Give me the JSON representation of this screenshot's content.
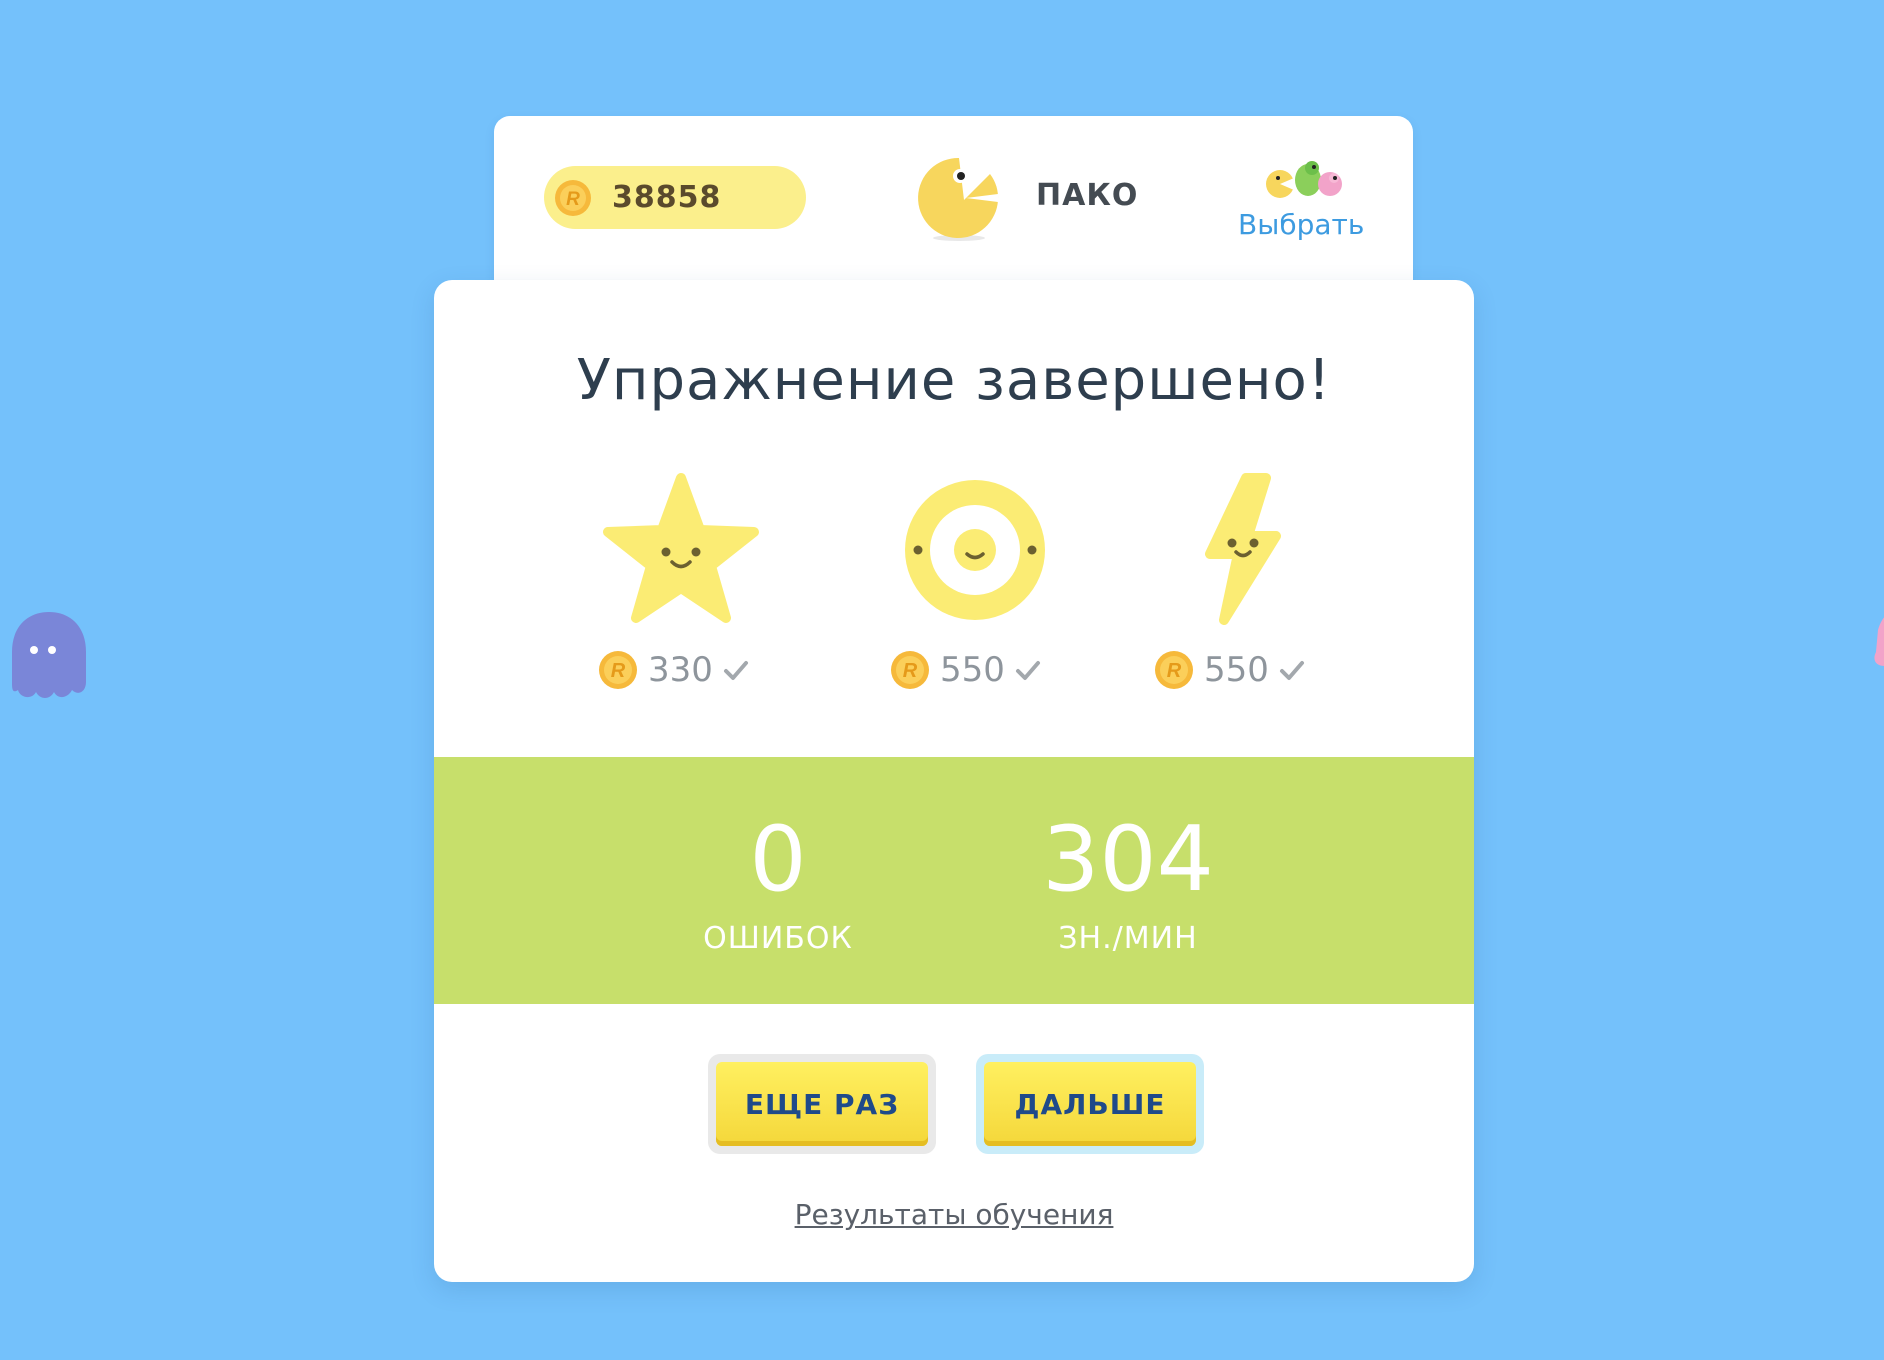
{
  "header": {
    "coins": "38858",
    "character_name": "ПАКО",
    "choose_link": "Выбрать"
  },
  "result": {
    "title": "Упражнение завершено!",
    "badges": [
      {
        "icon": "star-icon",
        "reward": "330",
        "earned": true
      },
      {
        "icon": "target-icon",
        "reward": "550",
        "earned": true
      },
      {
        "icon": "lightning-icon",
        "reward": "550",
        "earned": true
      }
    ],
    "stats": {
      "errors_value": "0",
      "errors_label": "ОШИБОК",
      "speed_value": "304",
      "speed_label": "ЗН./МИН"
    },
    "buttons": {
      "again": "ЕЩЕ РАЗ",
      "next": "ДАЛЬШЕ"
    },
    "results_link": "Результаты обучения"
  },
  "colors": {
    "background": "#74c1fb",
    "coin_pill": "#fbef8c",
    "stats_band": "#c7df6b",
    "button_yellow": "#f4d73a",
    "button_text": "#1f4a8a",
    "link_blue": "#3d9be0"
  }
}
